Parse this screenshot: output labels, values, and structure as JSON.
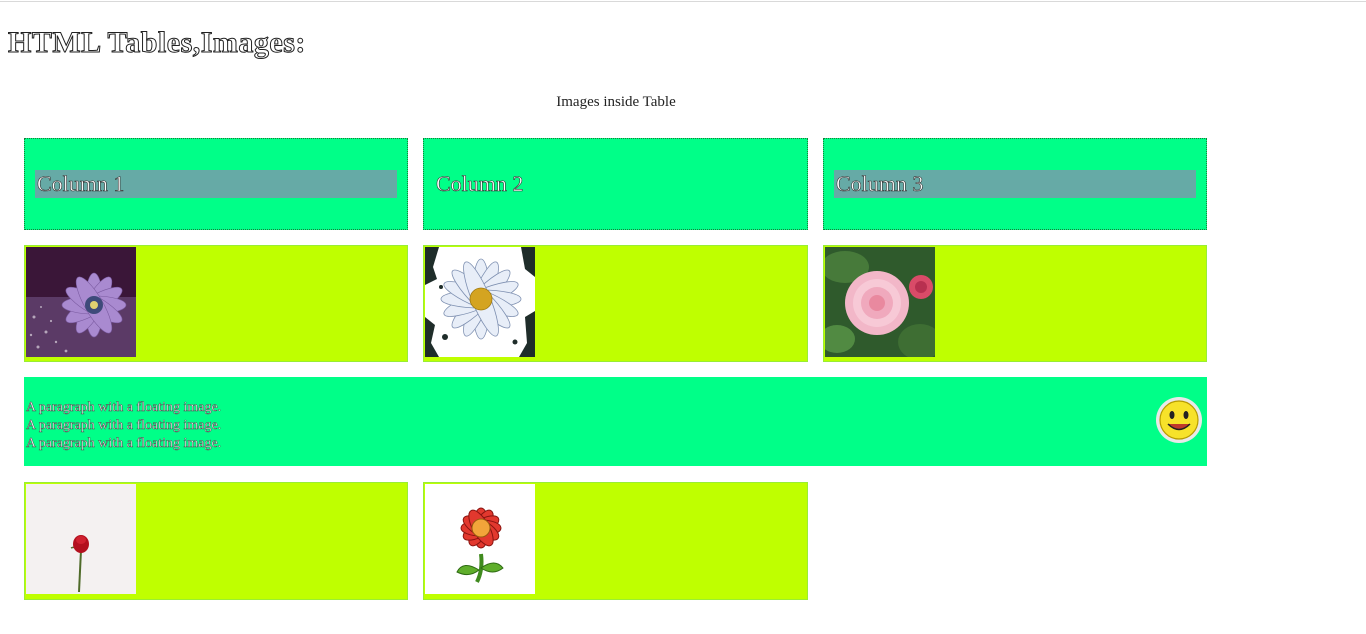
{
  "page": {
    "heading": "HTML Tables,Images:"
  },
  "table": {
    "caption": "Images inside Table",
    "headers": [
      "Column 1",
      "Column 2",
      "Column 3"
    ],
    "paragraph_lines": [
      "A paragraph with a floating image.",
      "A paragraph with a floating image.",
      "A paragraph with a floating image."
    ]
  },
  "icons": {
    "row1": [
      "purple-daisy-icon",
      "white-daisy-icon",
      "pink-camellia-icon"
    ],
    "float": "smiley-face-icon",
    "row3": [
      "red-rose-icon",
      "red-flower-icon"
    ]
  },
  "colors": {
    "header_bg": "#00ff88",
    "row_bg": "#bfff00",
    "header_label_bg": "#66aaa6"
  }
}
